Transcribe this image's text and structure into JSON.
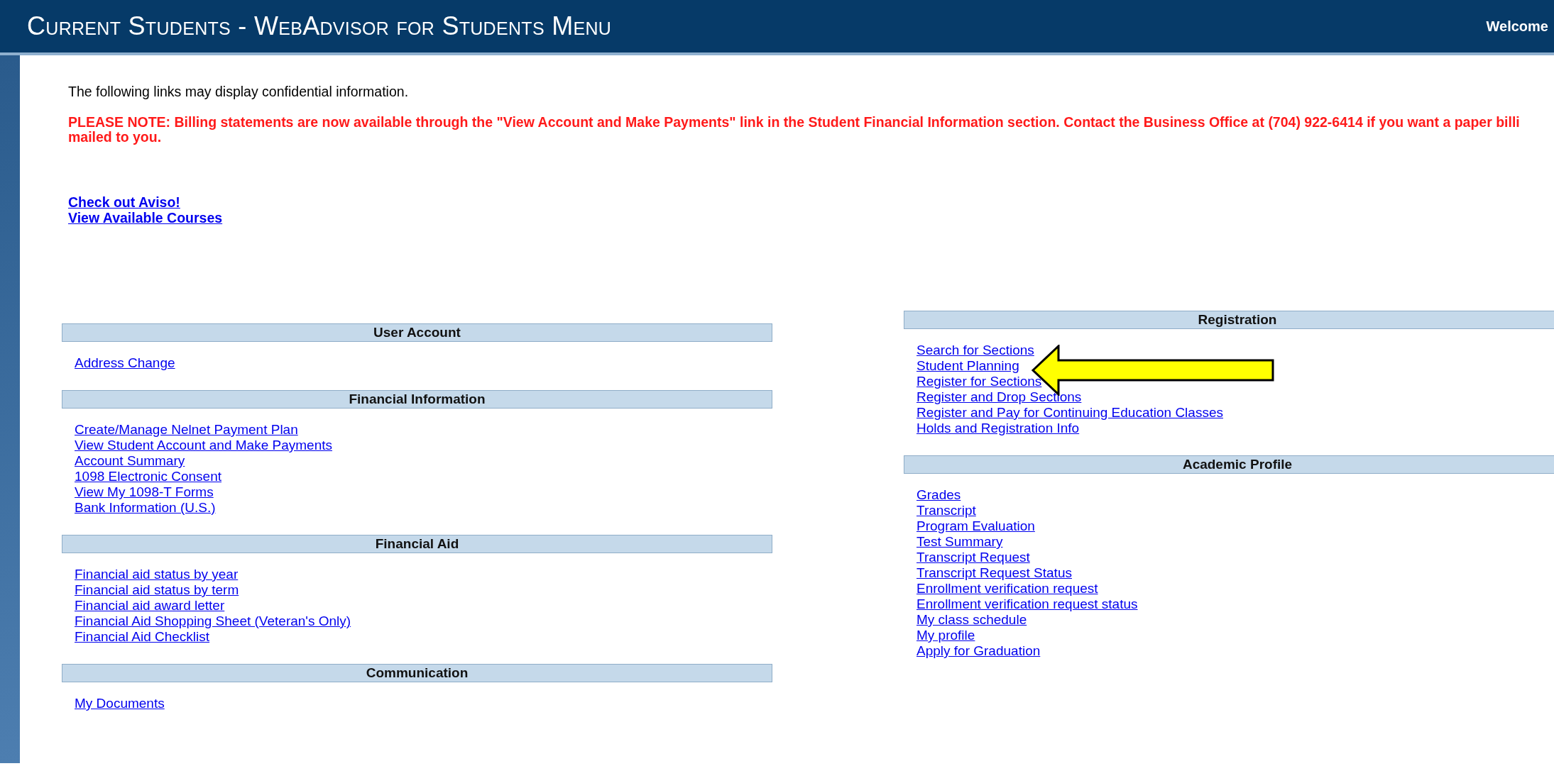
{
  "header": {
    "title": "Current Students - WebAdvisor for Students Menu",
    "welcome": "Welcome"
  },
  "intro": "The following links may display confidential information.",
  "notice": [
    "PLEASE NOTE: Billing statements are now available through the \"View Account and Make Payments\" link in the Student Financial Information section. Contact the Business Office at (704) 922-6414 if you want a paper billi",
    "mailed to you."
  ],
  "top_links": [
    "Check out Aviso!",
    "View Available Courses"
  ],
  "columns": [
    {
      "sections": [
        {
          "title": "User Account",
          "links": [
            "Address Change"
          ]
        },
        {
          "title": "Financial Information",
          "links": [
            "Create/Manage Nelnet Payment Plan",
            "View Student Account and Make Payments",
            "Account Summary",
            "1098 Electronic Consent",
            "View My 1098-T Forms",
            "Bank Information (U.S.)"
          ]
        },
        {
          "title": "Financial Aid",
          "links": [
            "Financial aid status by year",
            "Financial aid status by term",
            "Financial aid award letter",
            "Financial Aid Shopping Sheet (Veteran's Only)",
            "Financial Aid Checklist"
          ]
        },
        {
          "title": "Communication",
          "links": [
            "My Documents"
          ]
        }
      ]
    },
    {
      "sections": [
        {
          "title": "Registration",
          "links": [
            "Search for Sections",
            "Student Planning",
            "Register for Sections",
            "Register and Drop Sections",
            "Register and Pay for Continuing Education Classes",
            "Holds and Registration Info"
          ]
        },
        {
          "title": "Academic Profile",
          "links": [
            "Grades",
            "Transcript",
            "Program Evaluation",
            "Test Summary",
            "Transcript Request",
            "Transcript Request Status",
            "Enrollment verification request",
            "Enrollment verification request status",
            "My class schedule",
            "My profile",
            "Apply for Graduation"
          ]
        }
      ]
    }
  ]
}
